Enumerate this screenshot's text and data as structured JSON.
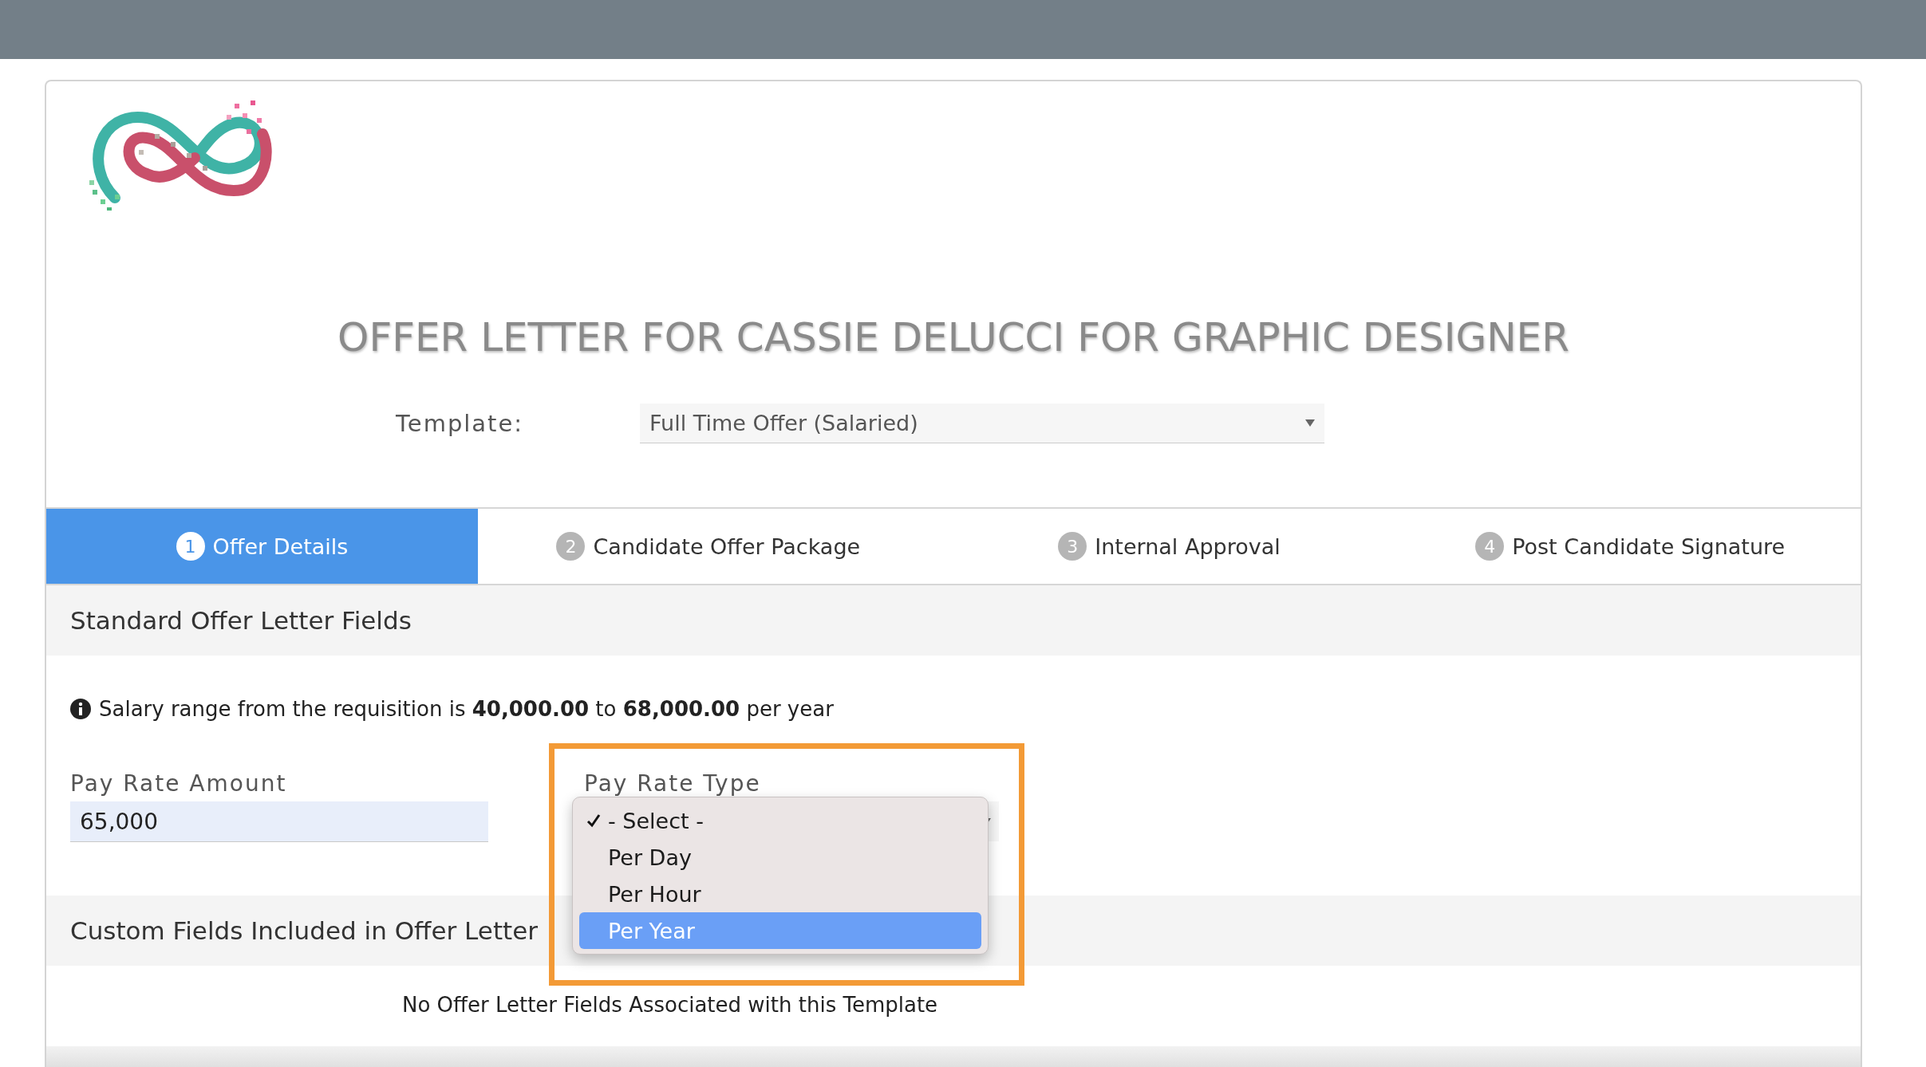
{
  "title": "OFFER LETTER FOR CASSIE DELUCCI FOR GRAPHIC DESIGNER",
  "template": {
    "label": "Template:",
    "value": "Full Time Offer (Salaried)"
  },
  "tabs": [
    {
      "number": "1",
      "label": "Offer Details",
      "selected": true
    },
    {
      "number": "2",
      "label": "Candidate Offer Package",
      "selected": false
    },
    {
      "number": "3",
      "label": "Internal Approval",
      "selected": false
    },
    {
      "number": "4",
      "label": "Post Candidate Signature",
      "selected": false
    }
  ],
  "standard_section": {
    "heading": "Standard Offer Letter Fields",
    "salary_note": "Salary range from the requisition is **40,000.00** to **68,000.00** per year"
  },
  "pay_rate_amount": {
    "label": "Pay Rate Amount",
    "value": "65,000"
  },
  "pay_rate_type": {
    "label": "Pay Rate Type",
    "options": [
      {
        "label": "- Select -",
        "checked": true,
        "selected": false
      },
      {
        "label": "Per Day",
        "checked": false,
        "selected": false
      },
      {
        "label": "Per Hour",
        "checked": false,
        "selected": false
      },
      {
        "label": "Per Year",
        "checked": false,
        "selected": true
      }
    ]
  },
  "custom_section": {
    "heading": "Custom Fields Included in Offer Letter",
    "empty_message": "No Offer Letter Fields Associated with this Template"
  }
}
